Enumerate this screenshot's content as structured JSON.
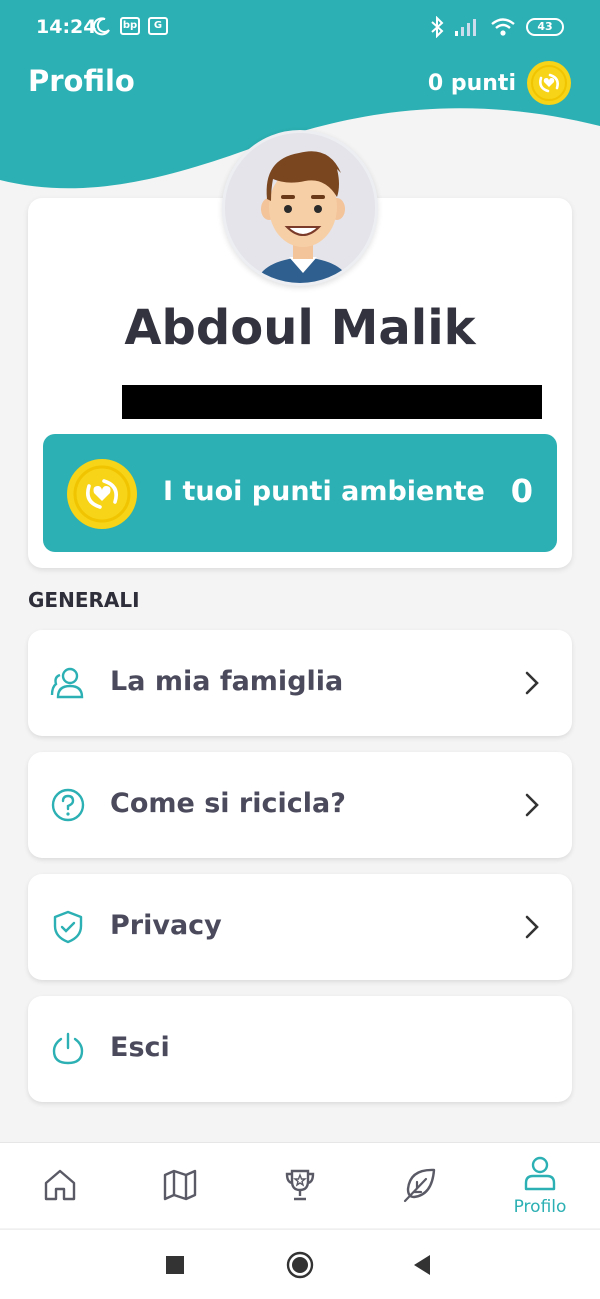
{
  "colors": {
    "accent": "#2cb0b3",
    "coin": "#f7d417",
    "text_dark": "#33333f"
  },
  "status_bar": {
    "time": "14:24",
    "left_icons": [
      "moon-icon",
      "bp-badge-icon",
      "gallery-icon"
    ],
    "badges": {
      "bp": "bp",
      "gallery": "G"
    },
    "right_icons": [
      "bluetooth-icon",
      "signal-icon",
      "wifi-icon",
      "battery-icon"
    ],
    "battery": "43"
  },
  "header": {
    "title": "Profilo",
    "points_label": "0 punti",
    "coin_icon": "coin-icon"
  },
  "profile": {
    "name": "Abdoul Malik",
    "points_banner": {
      "label": "I tuoi punti ambiente",
      "value": "0"
    }
  },
  "section": {
    "title": "GENERALI"
  },
  "menu": [
    {
      "label": "La mia famiglia",
      "icon": "family-icon",
      "has_chevron": true
    },
    {
      "label": "Come si ricicla?",
      "icon": "help-icon",
      "has_chevron": true
    },
    {
      "label": "Privacy",
      "icon": "shield-check-icon",
      "has_chevron": true
    },
    {
      "label": "Esci",
      "icon": "power-icon",
      "has_chevron": false
    }
  ],
  "bottom_nav": [
    {
      "icon": "home-icon",
      "label": ""
    },
    {
      "icon": "map-icon",
      "label": ""
    },
    {
      "icon": "trophy-icon",
      "label": ""
    },
    {
      "icon": "leaf-icon",
      "label": ""
    },
    {
      "icon": "profile-icon",
      "label": "Profilo",
      "active": true
    }
  ],
  "system_nav": [
    "recents-icon",
    "home-circle-icon",
    "back-icon"
  ]
}
